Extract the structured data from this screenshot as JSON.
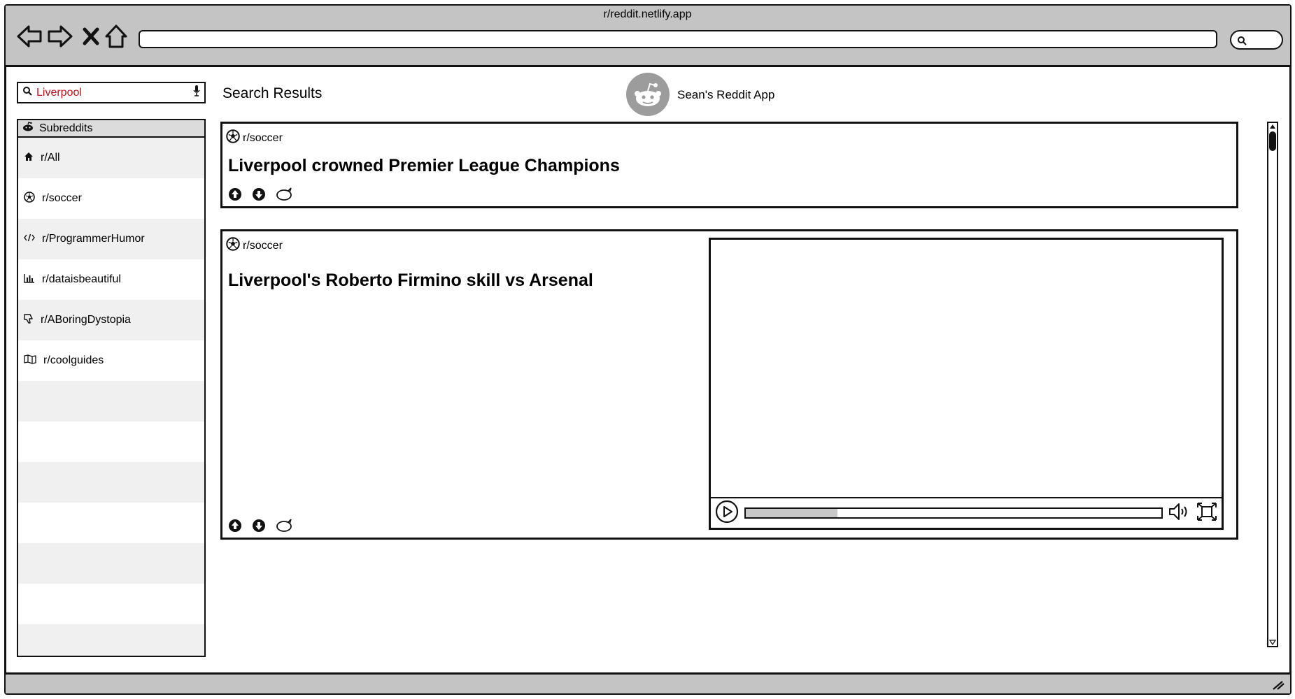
{
  "browser": {
    "url_title": "r/reddit.netlify.app",
    "buttons": [
      "back-icon",
      "forward-icon",
      "close-icon",
      "home-icon"
    ]
  },
  "search": {
    "value": "Liverpool",
    "icon": "search-icon",
    "mic_icon": "microphone-icon"
  },
  "sidebar": {
    "header": {
      "label": "Subreddits",
      "icon": "reddit-icon"
    },
    "items": [
      {
        "label": "r/All",
        "icon": "home-icon"
      },
      {
        "label": "r/soccer",
        "icon": "soccer-ball-icon"
      },
      {
        "label": "r/ProgrammerHumor",
        "icon": "code-icon"
      },
      {
        "label": "r/dataisbeautiful",
        "icon": "bar-chart-icon"
      },
      {
        "label": "r/ABoringDystopia",
        "icon": "thumbs-down-icon"
      },
      {
        "label": "r/coolguides",
        "icon": "map-icon"
      }
    ]
  },
  "header": {
    "title": "Search Results",
    "app_name": "Sean's Reddit App",
    "logo_icon": "reddit-logo-icon"
  },
  "posts": [
    {
      "subreddit": "r/soccer",
      "title": "Liverpool crowned Premier League Champions",
      "has_video": false
    },
    {
      "subreddit": "r/soccer",
      "title": "Liverpool's Roberto Firmino skill vs Arsenal",
      "has_video": true,
      "video": {
        "progress": 0.22
      }
    }
  ],
  "colors": {
    "chrome": "#c4c4c4",
    "search_text": "#c0141b",
    "avatar": "#9c9c9c"
  }
}
